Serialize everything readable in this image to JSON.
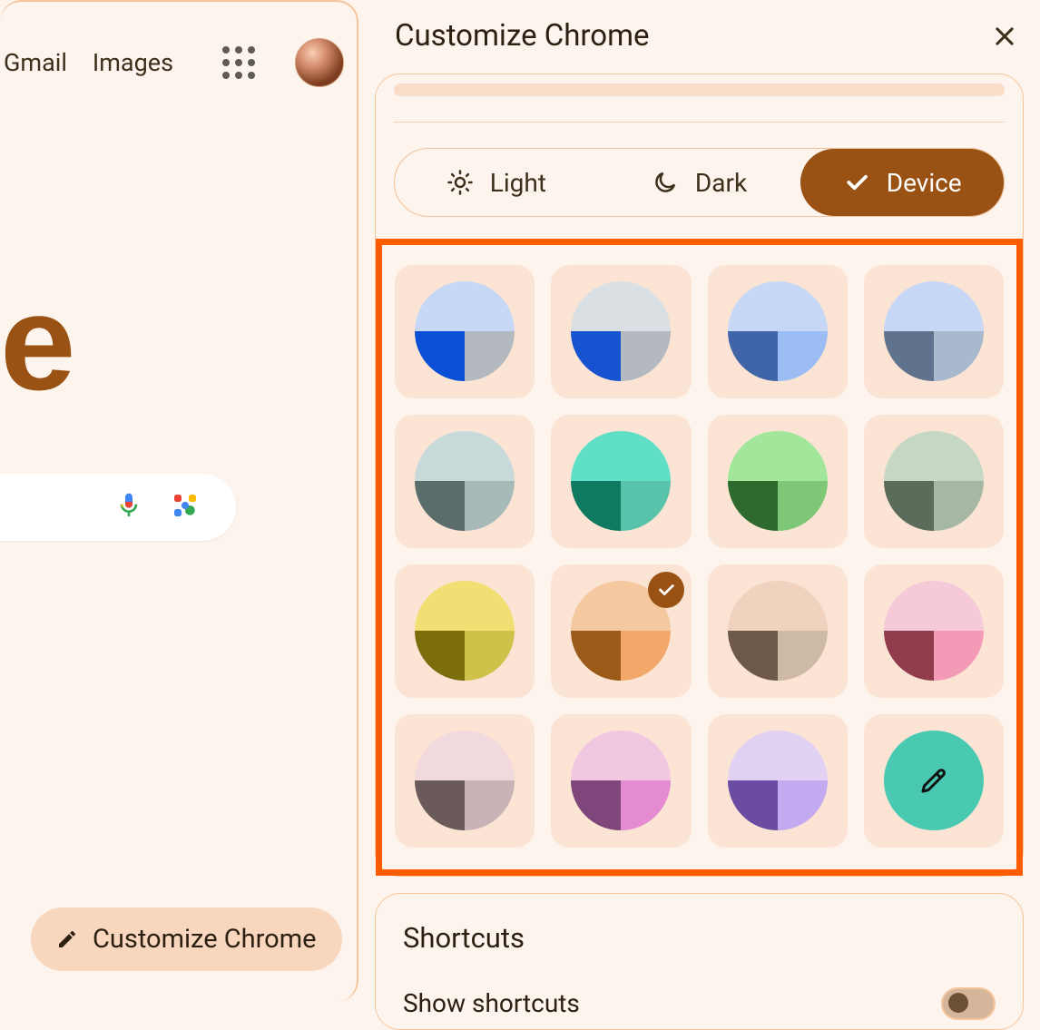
{
  "top_nav": {
    "gmail": "Gmail",
    "images": "Images"
  },
  "customize_button": {
    "label": "Customize Chrome"
  },
  "panel": {
    "title": "Customize Chrome",
    "modes": {
      "light": "Light",
      "dark": "Dark",
      "device": "Device",
      "selected": "device"
    },
    "selected_swatch_index": 9
  },
  "swatches": [
    {
      "top": "#c7d8f6",
      "bl": "#0a4fd6",
      "br": "#b3b9bf"
    },
    {
      "top": "#dadfe3",
      "bl": "#1753d1",
      "br": "#b3b9bf"
    },
    {
      "top": "#c7d8f6",
      "bl": "#3f64a8",
      "br": "#9cbdf3"
    },
    {
      "top": "#c7d8f6",
      "bl": "#5f738d",
      "br": "#a8b8cd"
    },
    {
      "top": "#c7dad9",
      "bl": "#5b6d6a",
      "br": "#a8bab7"
    },
    {
      "top": "#5fe0c6",
      "bl": "#0f7a60",
      "br": "#58c2aa"
    },
    {
      "top": "#a1e69a",
      "bl": "#2e6a2e",
      "br": "#7dc777"
    },
    {
      "top": "#c6d7c4",
      "bl": "#5b6d5a",
      "br": "#a6b8a3"
    },
    {
      "top": "#f2df74",
      "bl": "#7c6d0c",
      "br": "#cfc24b"
    },
    {
      "top": "#f4c9a0",
      "bl": "#9b5a19",
      "br": "#f2a86a"
    },
    {
      "top": "#f0d3bf",
      "bl": "#6e5848",
      "br": "#cdb9a5"
    },
    {
      "top": "#f5c9d8",
      "bl": "#913c4c",
      "br": "#f39bb6"
    },
    {
      "top": "#f2d9de",
      "bl": "#6a5a5a",
      "br": "#c9b3b6"
    },
    {
      "top": "#f2c7e0",
      "bl": "#7e467a",
      "br": "#e48bd1"
    },
    {
      "top": "#e1d2f3",
      "bl": "#6a4da3",
      "br": "#c3a9ef"
    }
  ],
  "shortcuts": {
    "title": "Shortcuts",
    "show_label": "Show shortcuts",
    "enabled": true
  }
}
